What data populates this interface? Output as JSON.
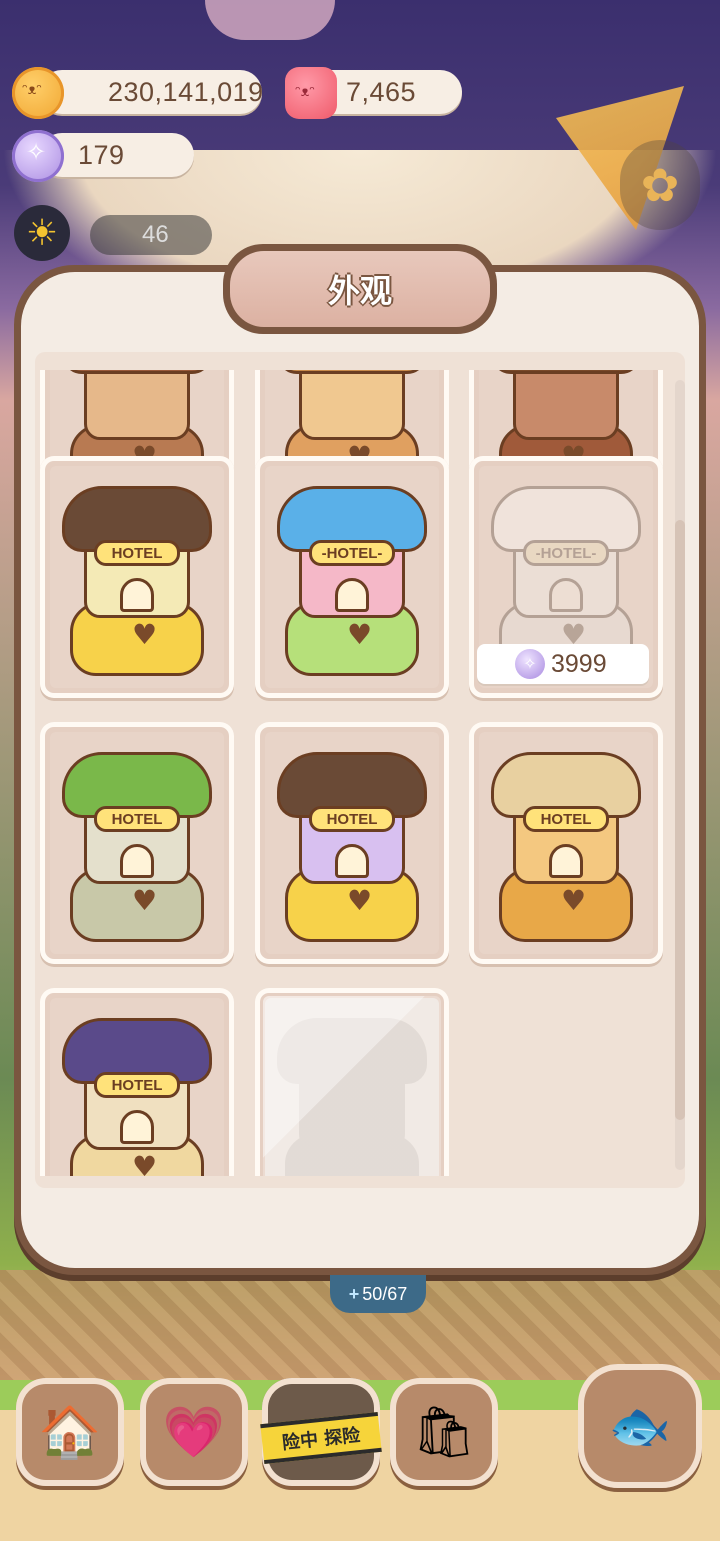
{
  "currencies": {
    "cookies": "230,141,019",
    "jellies": "7,465",
    "gems": "179"
  },
  "player": {
    "level": "46"
  },
  "modal": {
    "title": "外观",
    "price_label": "3999"
  },
  "progress": {
    "text": "50/67",
    "plus": "+"
  },
  "bottom_nav": {
    "explore_label": "险中 探险"
  },
  "icons": {
    "cookie": "cookie-currency-icon",
    "jelly": "jelly-currency-icon",
    "gem": "gem-currency-icon",
    "settings": "gear-icon",
    "home": "mushroom-house-icon",
    "diary": "heart-diary-icon",
    "explore": "explore-icon",
    "shop": "shop-bag-icon",
    "pet": "fish-pet-icon"
  },
  "skins": [
    {
      "id": "top-partial-1",
      "roof": "#9a5a3a",
      "body": "#e6b88a",
      "base": "#b87a52",
      "state": "owned"
    },
    {
      "id": "top-partial-2",
      "roof": "#c88a4a",
      "body": "#f0c890",
      "base": "#e0a060",
      "state": "owned"
    },
    {
      "id": "top-partial-3",
      "roof": "#7a4a2a",
      "body": "#c88a6a",
      "base": "#a05a3a",
      "state": "owned"
    },
    {
      "id": "blossom-hotel",
      "sign": "HOTEL",
      "roof": "#6a4a36",
      "body": "#f4eab6",
      "base": "#f7d24a",
      "state": "owned"
    },
    {
      "id": "balloon-hotel",
      "sign": "-HOTEL-",
      "roof": "#5ab0e8",
      "body": "#f5b8c8",
      "base": "#b6e07a",
      "state": "owned"
    },
    {
      "id": "white-flower-hotel",
      "sign": "-HOTEL-",
      "roof": "#ffffff",
      "body": "#f4f1ea",
      "base": "#e9e4da",
      "state": "purchasable"
    },
    {
      "id": "moss-hotel",
      "sign": "HOTEL",
      "roof": "#7ab84a",
      "body": "#e4e0cc",
      "base": "#c8c8a8",
      "state": "owned"
    },
    {
      "id": "candy-dot-hotel",
      "sign": "HOTEL",
      "roof": "#6a4a36",
      "body": "#d8c0f0",
      "base": "#f7d24a",
      "state": "owned"
    },
    {
      "id": "sweets-hotel",
      "sign": "HOTEL",
      "roof": "#e8d0a0",
      "body": "#f4c880",
      "base": "#e8a848",
      "state": "owned"
    },
    {
      "id": "shrine-hotel",
      "sign": "HOTEL",
      "roof": "#5a4a8a",
      "body": "#f0e0c0",
      "base": "#f0d8a0",
      "state": "owned"
    },
    {
      "id": "silhouette",
      "state": "locked"
    }
  ]
}
